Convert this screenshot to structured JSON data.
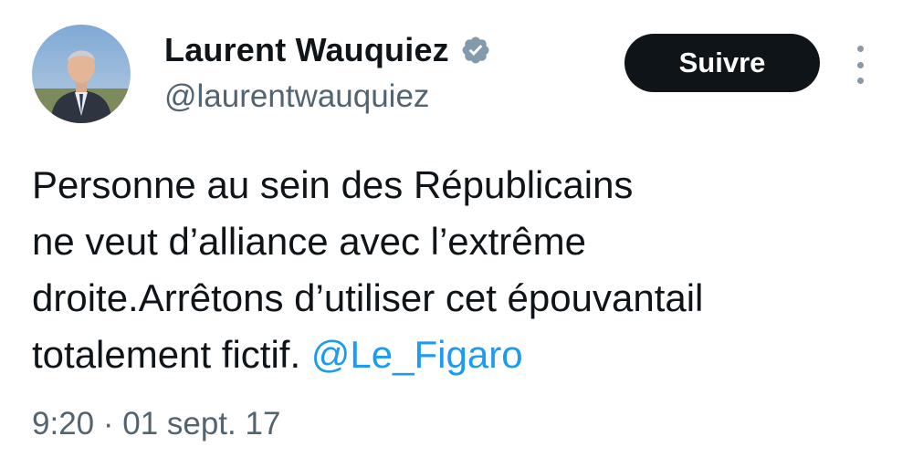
{
  "author": {
    "display_name": "Laurent Wauquiez",
    "handle": "@laurentwauquiez",
    "verified_icon": "verified-badge-icon"
  },
  "actions": {
    "follow_label": "Suivre",
    "more_icon": "more-options-icon"
  },
  "tweet": {
    "lines": [
      "Personne au sein des Républicains",
      "ne veut d’alliance avec l’extrême",
      "droite.Arrêtons d’utiliser cet épouvantail",
      "totalement fictif. "
    ],
    "mention": "@Le_Figaro"
  },
  "meta": {
    "timestamp": "9:20 · 01 sept. 17"
  },
  "colors": {
    "text": "#0f1419",
    "secondary": "#536471",
    "link": "#1d9bf0",
    "button_bg": "#0f1419",
    "badge": "#829aab"
  }
}
